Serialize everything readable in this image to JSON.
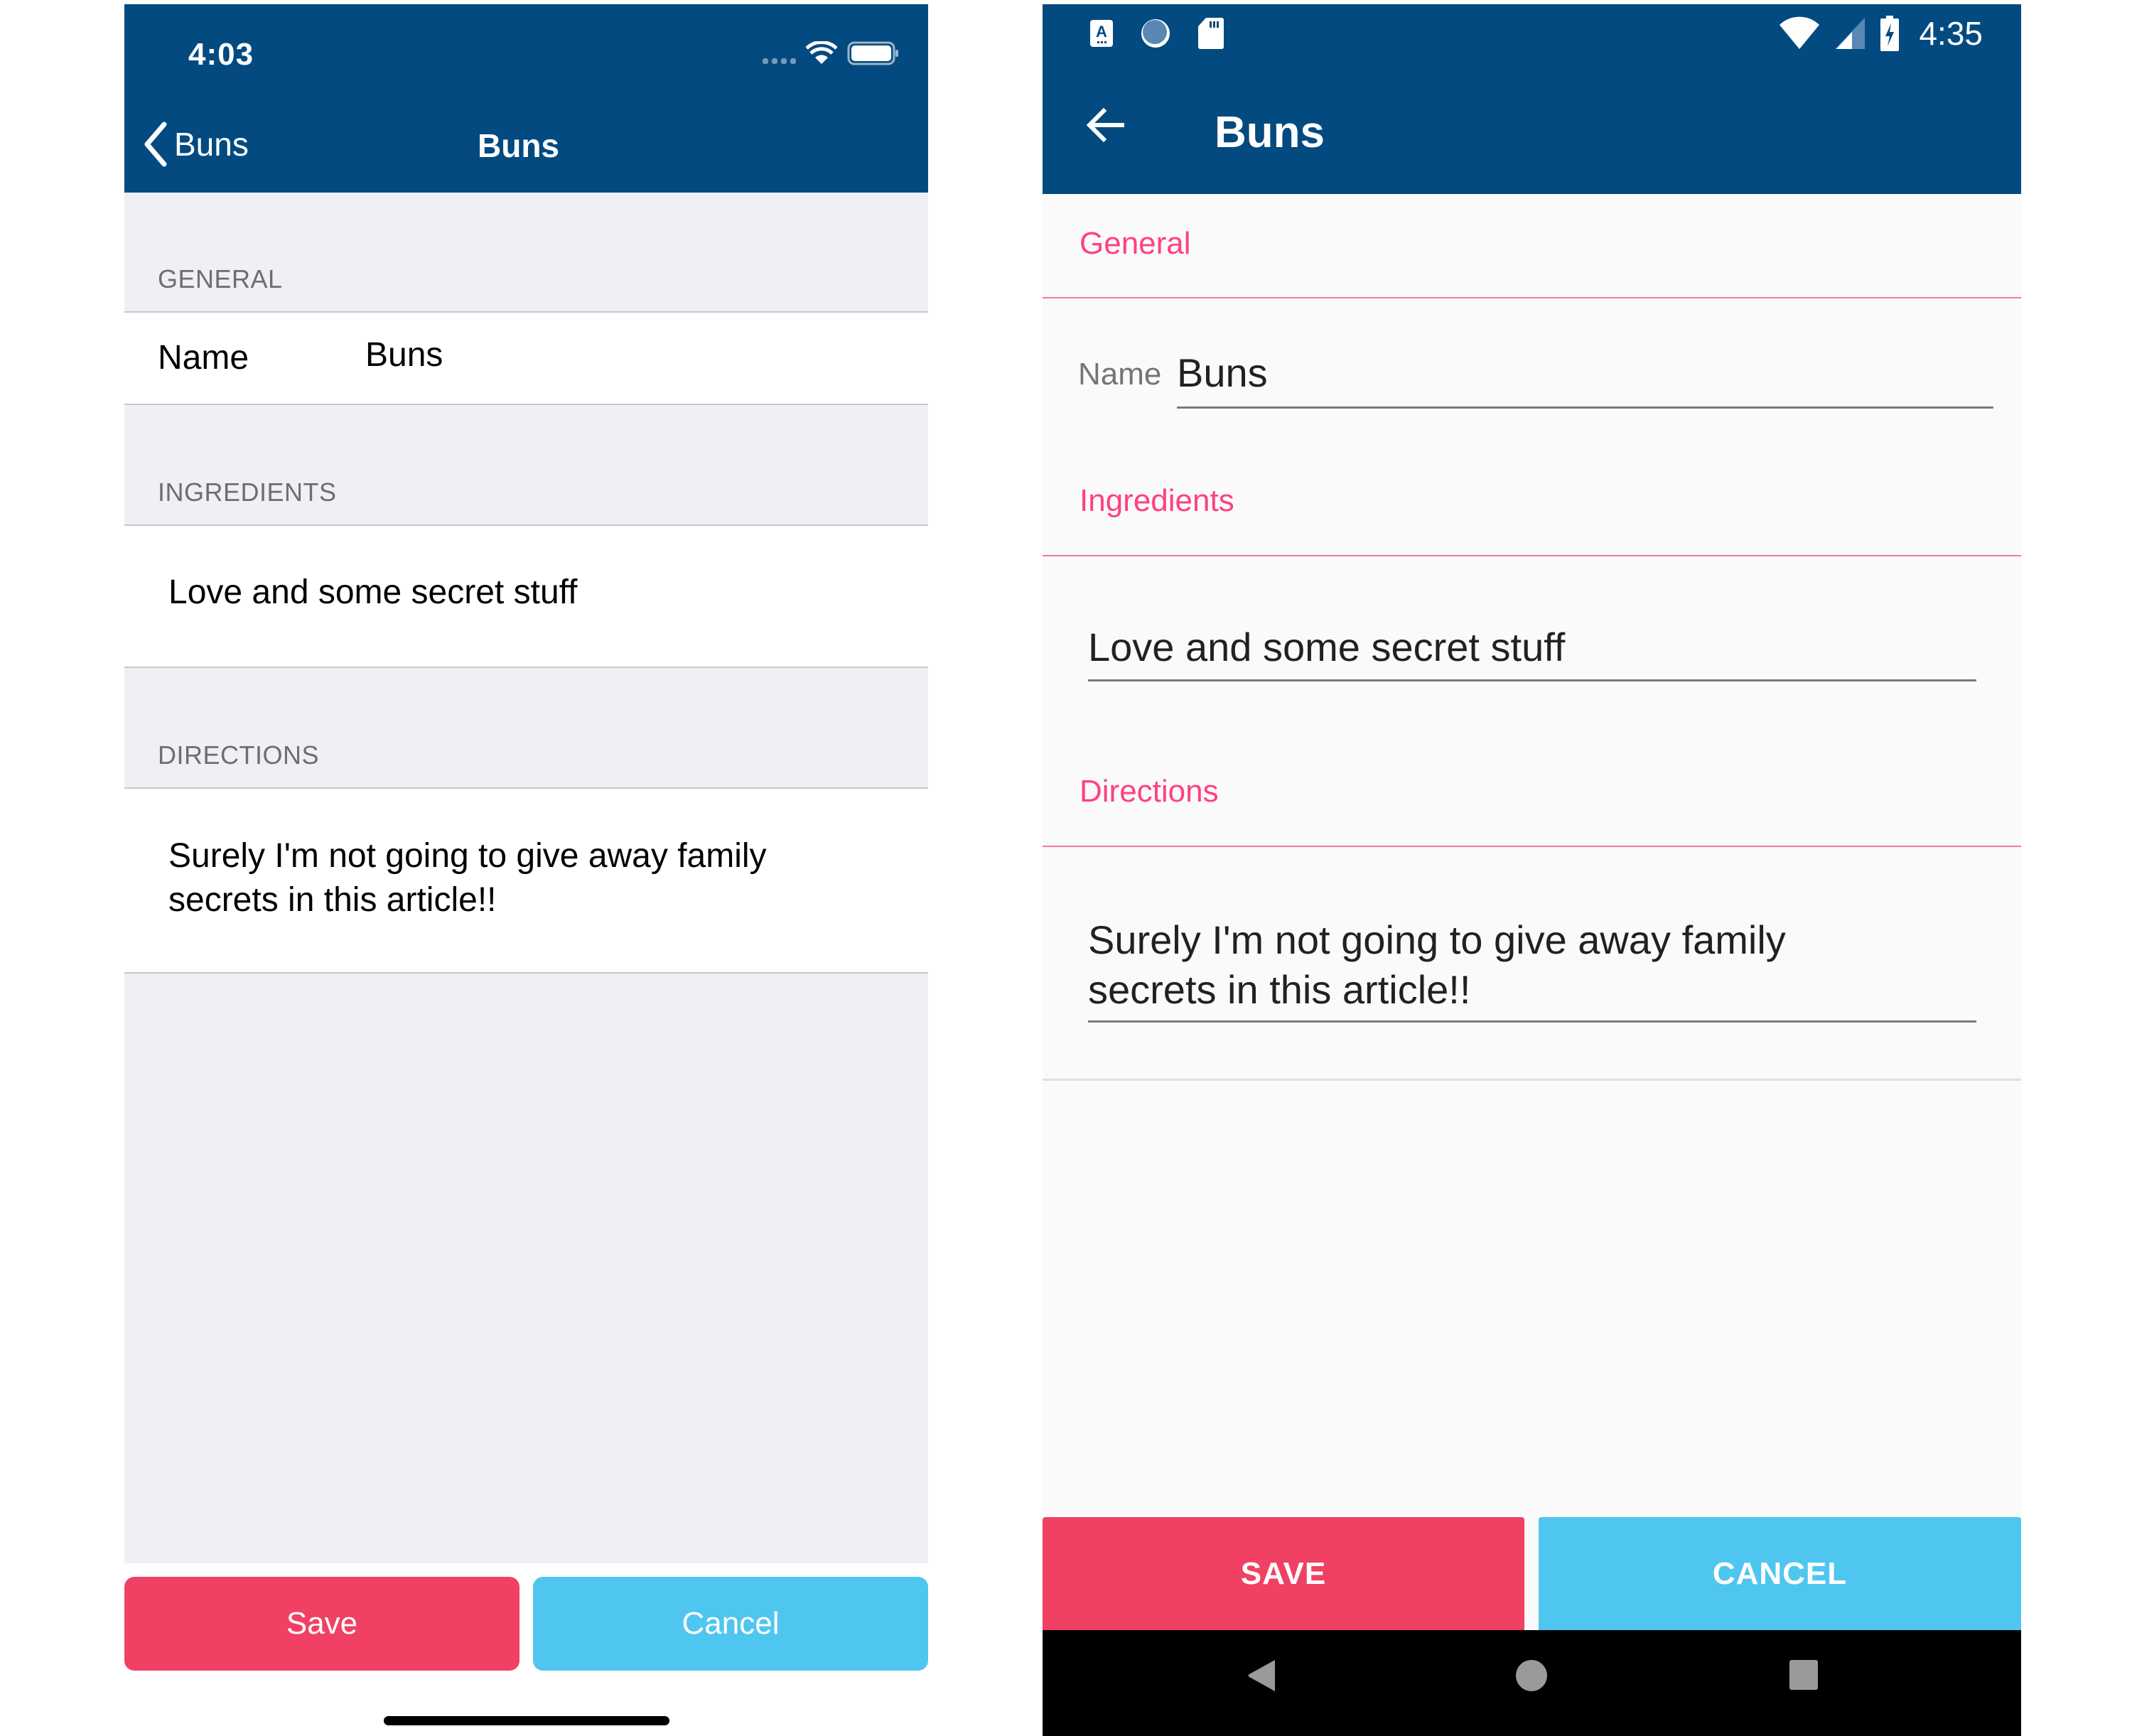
{
  "ios": {
    "status_bar": {
      "time": "4:03",
      "icons": [
        "signal-dots-icon",
        "wifi-icon",
        "battery-icon"
      ]
    },
    "nav": {
      "back_label": "Buns",
      "title": "Buns",
      "back_icon": "chevron-left-icon"
    },
    "sections": {
      "general": {
        "header": "GENERAL",
        "name_label": "Name",
        "name_value": "Buns"
      },
      "ingredients": {
        "header": "INGREDIENTS",
        "value": "Love and some secret stuff"
      },
      "directions": {
        "header": "DIRECTIONS",
        "value_line1": "Surely I'm not going to give away family",
        "value_line2": "secrets in this article!!"
      }
    },
    "buttons": {
      "save": "Save",
      "cancel": "Cancel"
    }
  },
  "android": {
    "status_bar": {
      "time": "4:35",
      "left_icons": [
        "accessibility-a-icon",
        "sync-circle-icon",
        "sd-card-icon"
      ],
      "right_icons": [
        "wifi-icon",
        "cell-signal-icon",
        "battery-charging-icon"
      ]
    },
    "appbar": {
      "title": "Buns",
      "back_icon": "arrow-back-icon"
    },
    "sections": {
      "general": {
        "header": "General",
        "name_label": "Name",
        "name_value": "Buns"
      },
      "ingredients": {
        "header": "Ingredients",
        "value": "Love and some secret stuff"
      },
      "directions": {
        "header": "Directions",
        "value_line1": "Surely I'm not going to give away family",
        "value_line2": "secrets in this article!!"
      }
    },
    "buttons": {
      "save": "SAVE",
      "cancel": "CANCEL"
    },
    "nav_bar": [
      "back-triangle-icon",
      "home-circle-icon",
      "recents-square-icon"
    ]
  },
  "colors": {
    "header_blue": "#024a7f",
    "save_red": "#f04063",
    "cancel_blue": "#4fc6f0",
    "accent_pink": "#ff4081",
    "ios_group_bg": "#efeff4",
    "android_bg": "#fafafa"
  }
}
